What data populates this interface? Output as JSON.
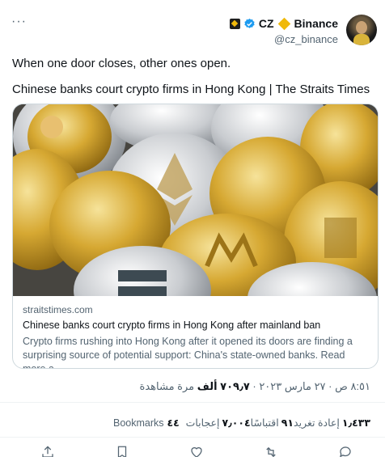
{
  "tweet": {
    "more_label": "···",
    "author_name": "CZ",
    "author_brand": "Binance",
    "author_handle": "@cz_binance",
    "text": "When one door closes, other ones open.",
    "link_headline": "Chinese banks court crypto firms in Hong Kong | The Straits Times"
  },
  "card": {
    "domain": "straitstimes.com",
    "title": "Chinese banks court crypto firms in Hong Kong after mainland ban",
    "description": "Crypto firms rushing into Hong Kong after it opened its doors are finding a surprising source of potential support: China's state-owned banks. Read more a..."
  },
  "meta": {
    "time": "٨:٥١ ص",
    "date": "٢٧ مارس ٢٠٢٣",
    "views_value": "٧٠٩٫٧ ألف",
    "views_label": "مرة مشاهدة"
  },
  "stats": {
    "retweets_value": "١٫٤٣٣",
    "retweets_label": "إعادة تغريد",
    "quotes_value": "٩١",
    "quotes_label": "اقتباسًا",
    "likes_value": "٧٫٠٠٤",
    "likes_label": "إعجابات",
    "bookmarks_value": "٤٤",
    "bookmarks_label": "Bookmarks"
  },
  "colors": {
    "verified": "#1d9bf0",
    "binance": "#f0b90b",
    "secondary_text": "#536471"
  },
  "icons": [
    "more-icon",
    "verified-icon",
    "share-icon",
    "bookmark-icon",
    "like-icon",
    "retweet-icon",
    "reply-icon"
  ]
}
